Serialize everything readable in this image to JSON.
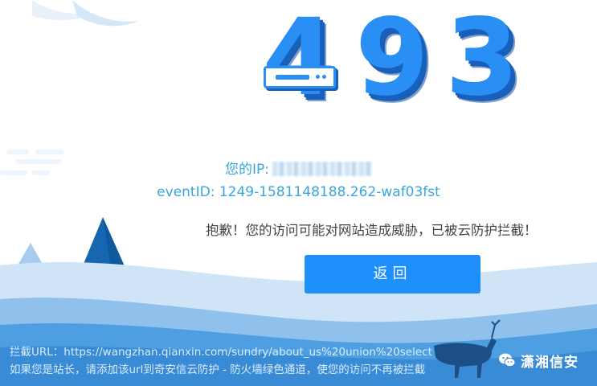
{
  "error": {
    "code_digits": [
      "4",
      "9",
      "3"
    ],
    "ip_label": "您的IP:",
    "event_id": "eventID: 1249-1581148188.262-waf03fst",
    "message": "抱歉！您的访问可能对网站造成威胁，已被云防护拦截！"
  },
  "actions": {
    "back_label": "返回"
  },
  "footer": {
    "blocked_url": "拦截URL：https://wangzhan.qianxin.com/sundry/about_us%20union%20select",
    "owner_hint": "如果您是站长，请添加该url到奇安信云防护 - 防火墙绿色通道，使您的访问不再被拦截"
  },
  "watermark": {
    "account_name": "潇湘信安",
    "icon": "wechat-icon"
  },
  "colors": {
    "accent": "#1e8ffb",
    "digit": "#2a8ff5",
    "info_text": "#39a6d9",
    "message_text": "#444444",
    "scenery_dark": "#1a6fb8",
    "scenery_light": "#5aa9e6"
  }
}
